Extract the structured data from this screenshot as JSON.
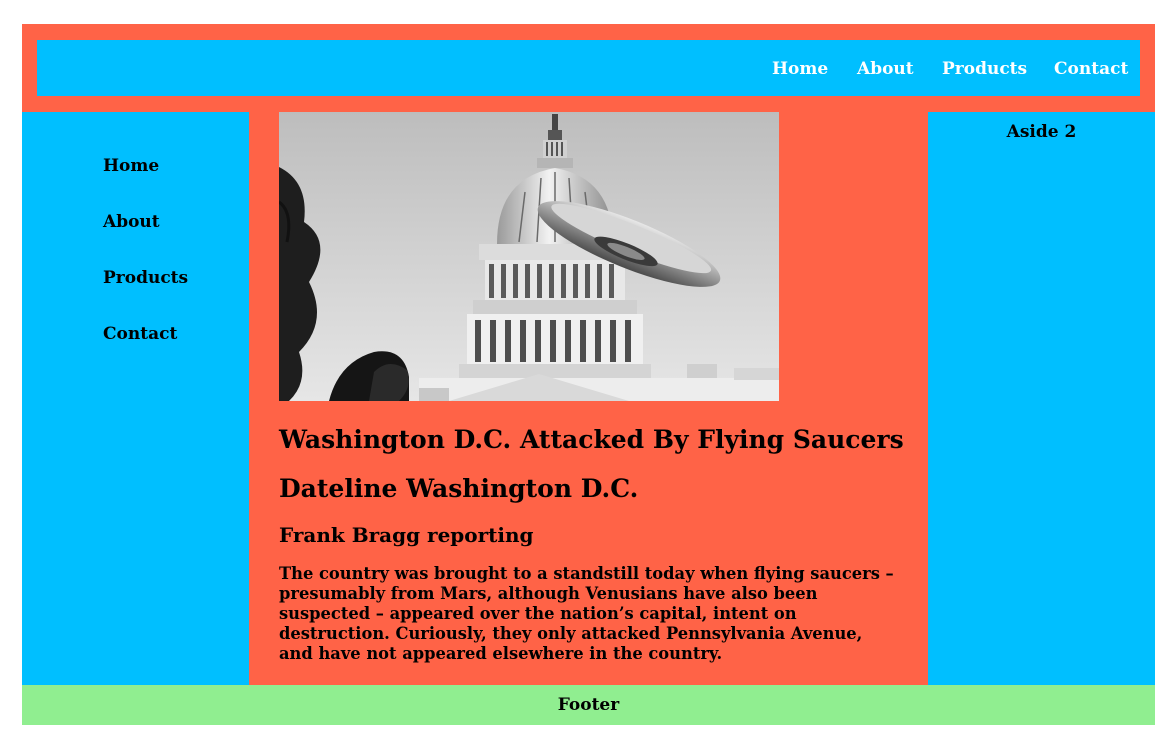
{
  "header": {
    "nav": [
      "Home",
      "About",
      "Products",
      "Contact"
    ]
  },
  "sidebar": {
    "nav": [
      "Home",
      "About",
      "Products",
      "Contact"
    ]
  },
  "article": {
    "headline": "Washington D.C. Attacked By Flying Saucers",
    "dateline": "Dateline Washington D.C.",
    "byline": "Frank Bragg reporting",
    "body": "The country was brought to a standstill today when flying saucers – presumably from Mars, although Venusians have also been suspected – appeared over the nation’s capital, intent on destruction. Curiously, they only attacked Pennsylvania Avenue, and have not appeared elsewhere in the country."
  },
  "aside": {
    "title": "Aside 2"
  },
  "footer": {
    "text": "Footer"
  },
  "colors": {
    "header_bg": "#ff6347",
    "nav_bg": "#00bfff",
    "aside_bg": "#00bfff",
    "main_bg": "#ff6347",
    "footer_bg": "#90ee90"
  }
}
